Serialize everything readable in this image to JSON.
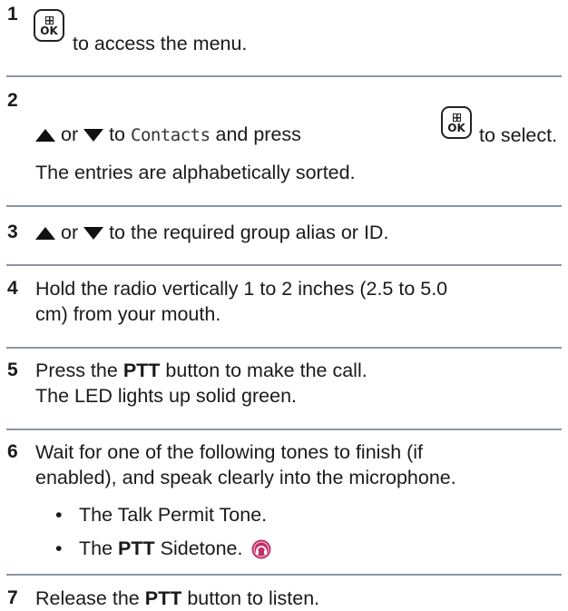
{
  "steps": [
    {
      "number": "1",
      "key": "OK",
      "text": "to access the menu."
    },
    {
      "number": "2",
      "or": "or",
      "to": "to",
      "menu_item": "Contacts",
      "and_press": "and press",
      "key": "OK",
      "to_select": "to select.",
      "note": "The entries are alphabetically sorted."
    },
    {
      "number": "3",
      "or": "or",
      "text": "to the required group alias or ID."
    },
    {
      "number": "4",
      "line1": "Hold the radio vertically 1 to 2 inches (2.5 to 5.0",
      "line2": "cm) from your mouth."
    },
    {
      "number": "5",
      "press": "Press the",
      "button": "PTT",
      "rest": "button to make the call.",
      "line2": "The LED lights up solid green."
    },
    {
      "number": "6",
      "line1": "Wait for one of the following tones to finish (if",
      "line2": "enabled), and speak clearly into the microphone.",
      "bullets": [
        {
          "text": "The Talk Permit Tone."
        },
        {
          "prefix": "The",
          "bold": "PTT",
          "suffix": "Sidetone."
        }
      ]
    },
    {
      "number": "7",
      "release": "Release the",
      "button": "PTT",
      "rest": "button to listen."
    }
  ],
  "icons": {
    "up": "up-triangle-icon",
    "down": "down-triangle-icon",
    "ok": "menu-ok-key-icon",
    "sidetone": "sidetone-icon"
  },
  "colors": {
    "rule": "#8c96a0",
    "text": "#1a1a1a",
    "sidetone_icon": "#c0306a"
  }
}
